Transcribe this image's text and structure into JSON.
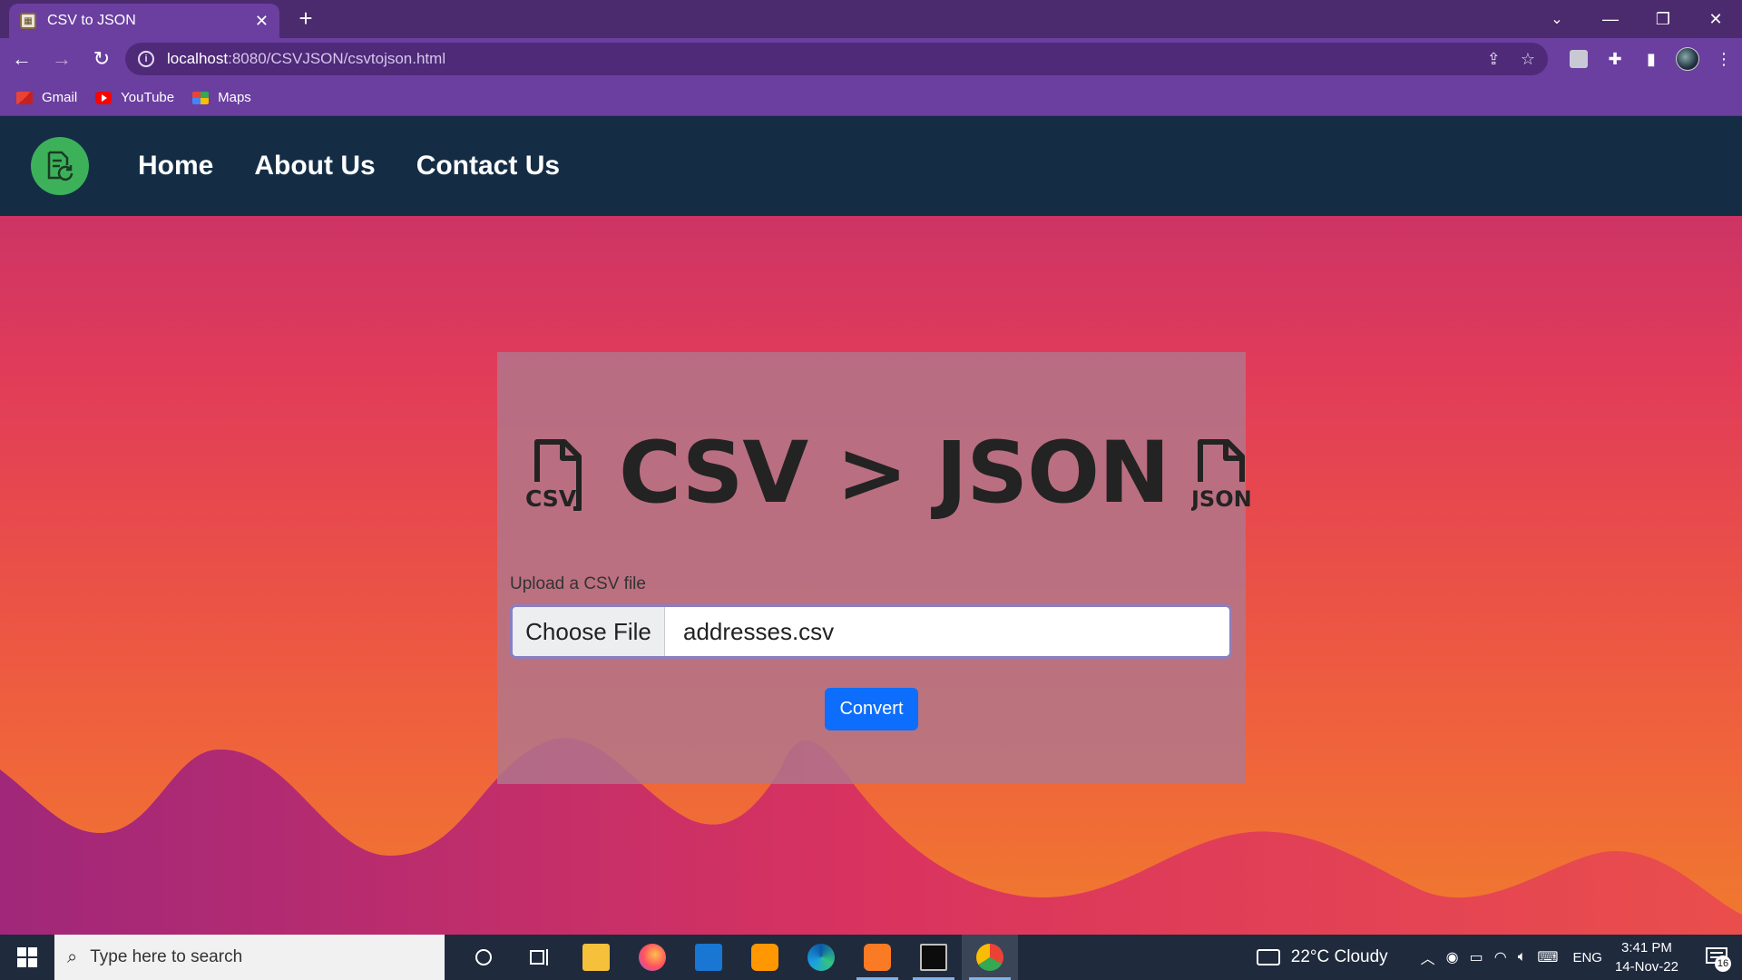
{
  "browser": {
    "tab_title": "CSV to JSON",
    "url_host": "localhost",
    "url_path": ":8080/CSVJSON/csvtojson.html",
    "bookmarks": [
      {
        "label": "Gmail",
        "icon": "gmail-icon"
      },
      {
        "label": "YouTube",
        "icon": "youtube-icon"
      },
      {
        "label": "Maps",
        "icon": "maps-icon"
      }
    ],
    "theme_color": "#6a3fa0"
  },
  "page": {
    "nav": {
      "links": [
        "Home",
        "About Us",
        "Contact Us"
      ],
      "logo_icon": "document-refresh-icon",
      "background": "#142d45"
    },
    "card": {
      "left_icon_label": "CSV",
      "right_icon_label": "JSON",
      "heading": "CSV > JSON",
      "upload_label": "Upload a CSV file",
      "choose_button": "Choose File",
      "selected_file": "addresses.csv",
      "convert_button": "Convert"
    },
    "accent_button_color": "#0d6efd"
  },
  "taskbar": {
    "search_placeholder": "Type here to search",
    "weather": "22°C  Cloudy",
    "language": "ENG",
    "time": "3:41 PM",
    "date": "14-Nov-22",
    "notification_count": "16"
  }
}
